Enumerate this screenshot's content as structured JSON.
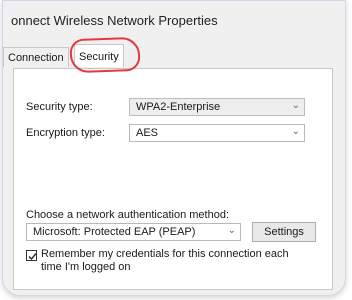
{
  "window": {
    "title": "onnect Wireless Network Properties"
  },
  "tabs": [
    {
      "label": "Connection",
      "active": false
    },
    {
      "label": "Security",
      "active": true
    }
  ],
  "security": {
    "type_label": "Security type:",
    "type_value": "WPA2-Enterprise",
    "encryption_label": "Encryption type:",
    "encryption_value": "AES",
    "method_label": "Choose a network authentication method:",
    "method_value": "Microsoft: Protected EAP (PEAP)",
    "settings_button": "Settings",
    "remember_text_line1": "Remember my credentials for this connection each",
    "remember_text_line2": "time I'm logged on",
    "remember_checked": true
  },
  "colors": {
    "annotation": "#e43a3a"
  }
}
